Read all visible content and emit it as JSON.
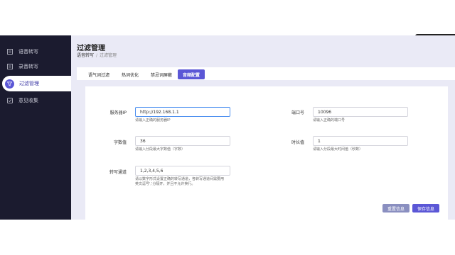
{
  "sidebar": {
    "items": [
      {
        "label": "语音转写",
        "icon": "document-icon",
        "active": false
      },
      {
        "label": "录音转写",
        "icon": "document-icon",
        "active": false
      },
      {
        "label": "过滤管理",
        "icon": "filter-icon",
        "active": true
      },
      {
        "label": "意见收集",
        "icon": "feedback-icon",
        "active": false
      }
    ]
  },
  "header": {
    "title": "过滤管理",
    "breadcrumb": {
      "root": "语音转写",
      "separator": "/",
      "current": "过滤管理"
    }
  },
  "tabs": [
    {
      "label": "语气词过滤",
      "active": false
    },
    {
      "label": "热词优化",
      "active": false
    },
    {
      "label": "禁忌词屏蔽",
      "active": false
    },
    {
      "label": "音频配置",
      "active": true
    }
  ],
  "form": {
    "server_ip": {
      "label": "服务器IP",
      "value": "http://192.168.1.1",
      "hint": "请输入正确的服务器IP"
    },
    "port": {
      "label": "端口号",
      "value": "10096",
      "hint": "请输入正确的端口号"
    },
    "char_count": {
      "label": "字数值",
      "value": "36",
      "hint": "请输入分段最大字数值（字数）"
    },
    "duration": {
      "label": "时长值",
      "value": "1",
      "hint": "请输入分段最大时间值（秒数）"
    },
    "channels": {
      "label": "转写通道",
      "value": "1,2,3,4,5,6",
      "hint_line1": "请以数字形式设置正确的转写通道，各转写通道间需要用",
      "hint_line2": "英文逗号','分隔开，并且不允许换行。"
    }
  },
  "buttons": {
    "reset": "重置信息",
    "save": "保存信息"
  },
  "colors": {
    "accent": "#5b57d6",
    "sidebar_bg": "#1b1b2f",
    "main_bg": "#eaeaf6"
  }
}
